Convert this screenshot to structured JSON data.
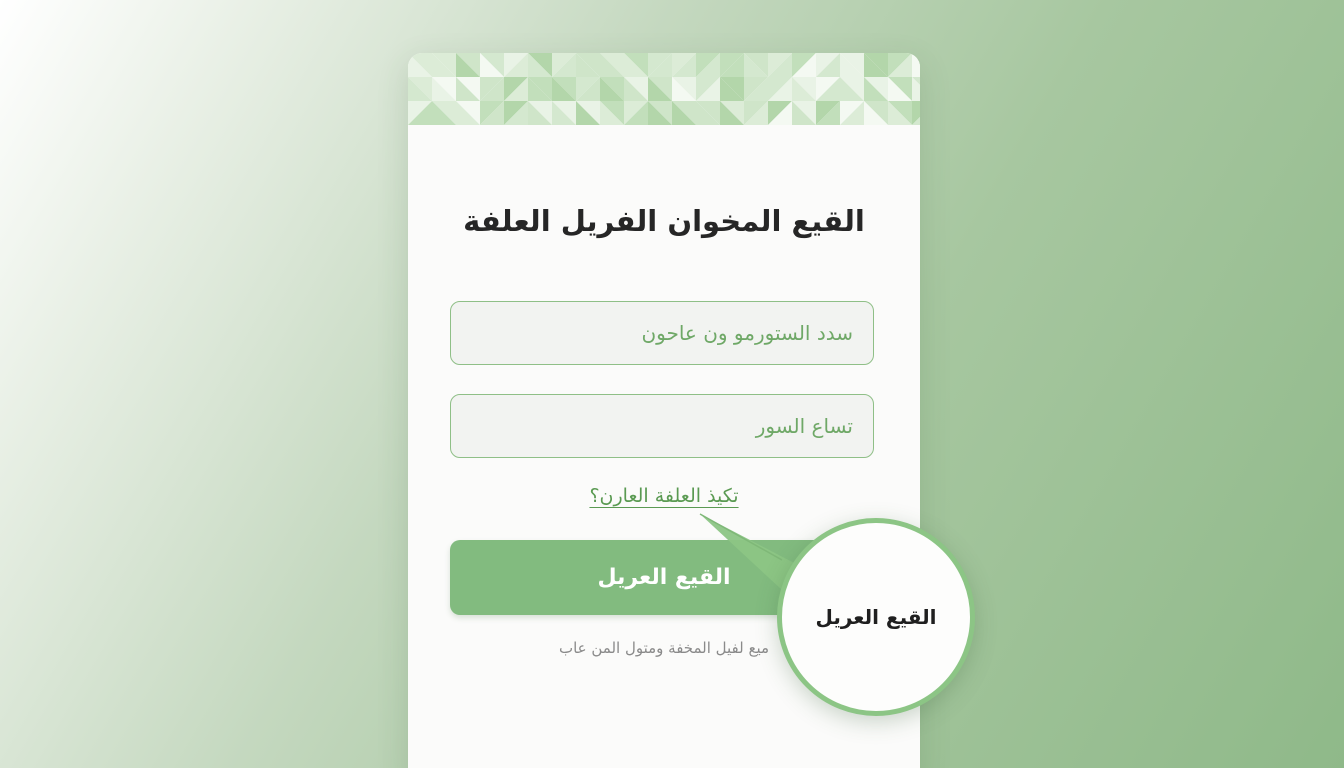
{
  "login_card": {
    "title": "القيع المخوان الفريل العلفة",
    "username_placeholder": "سدد الستورمو ون عاحون",
    "password_placeholder": "تساع السور",
    "forgot_link": "تكيذ العلفة العارن؟",
    "login_button": "القيع العريل",
    "footer_text": "ميع لفيل المخفة ومتول المن عاب"
  },
  "magnifier": {
    "label": "القيع العريل"
  },
  "colors": {
    "accent_green": "#82bb7f",
    "field_border": "#8fbf87",
    "link_green": "#5a9a52",
    "title_text": "#262626"
  }
}
